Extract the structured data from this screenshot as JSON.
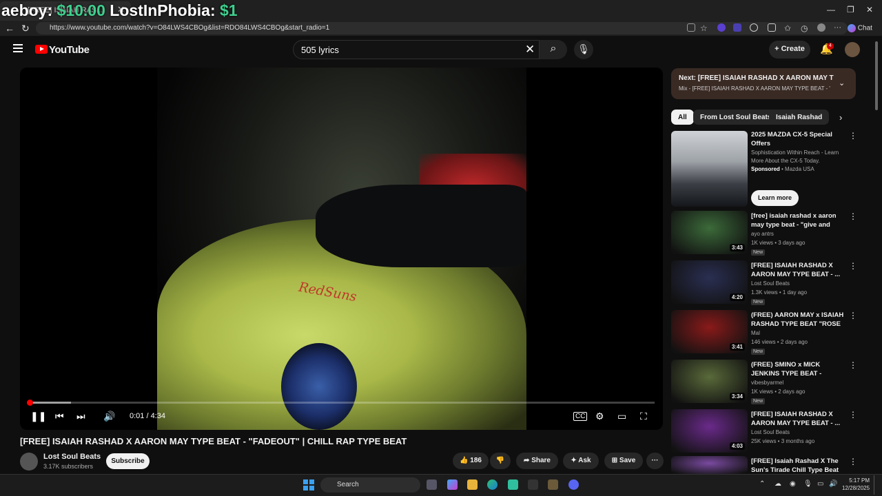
{
  "browser": {
    "tab_title": "[FREE] ISAIAH RAS...",
    "url": "https://www.youtube.com/watch?v=O84LWS4CBOg&list=RDO84LWS4CBOg&start_radio=1",
    "chat_label": "Chat"
  },
  "stream_overlay": {
    "name1": "aeboy: ",
    "amount1": "$10.00",
    "name2": "LostInPhobia: ",
    "amount2": "$1"
  },
  "youtube": {
    "logo_text": "YouTube",
    "search_value": "505 lyrics",
    "create_label": "Create",
    "notification_count": "4"
  },
  "player": {
    "watermark": "RedSuns",
    "time": "0:01 / 4:34",
    "progress_fraction": 0.002,
    "buffered_fraction": 0.068
  },
  "video": {
    "title": "[FREE] ISAIAH RASHAD X AARON MAY TYPE BEAT - \"FADEOUT\" | CHILL RAP TYPE BEAT",
    "channel": "Lost Soul Beats",
    "subscribers": "3.17K subscribers",
    "subscribe_label": "Subscribe",
    "likes": "186",
    "share_label": "Share",
    "ask_label": "Ask",
    "save_label": "Save"
  },
  "next": {
    "title": "Next: [FREE] ISAIAH RASHAD X AARON MAY TYPE ...",
    "subtitle": "Mix - [FREE] ISAIAH RASHAD X AARON MAY TYPE BEAT - \"F..."
  },
  "chips": [
    "All",
    "From Lost Soul Beats",
    "Isaiah Rashad"
  ],
  "ad": {
    "title": "2025 MAZDA CX-5 Special Offers",
    "desc": "Sophistication Within Reach - Learn More About the CX-5 Today.",
    "sponsored": "Sponsored",
    "advertiser": "Mazda USA",
    "cta": "Learn more"
  },
  "recommendations": [
    {
      "title": "[free] isaiah rashad x aaron may type beat - \"give and take\" | chi...",
      "channel": "ayo antrs",
      "meta": "1K views • 3 days ago",
      "badge": "New",
      "duration": "3:43",
      "color": "#3c6b3a"
    },
    {
      "title": "[FREE] ISAIAH RASHAD X AARON MAY TYPE BEAT - ...",
      "channel": "Lost Soul Beats",
      "meta": "1.3K views • 1 day ago",
      "badge": "New",
      "duration": "4:20",
      "color": "#2a2f52"
    },
    {
      "title": "(FREE) AARON MAY x ISAIAH RASHAD TYPE BEAT \"ROSE ...",
      "channel": "Mal",
      "meta": "146 views • 2 days ago",
      "badge": "New",
      "duration": "3:41",
      "color": "#8a1a1a"
    },
    {
      "title": "(FREE) SMINO x MICK JENKINS TYPE BEAT - \"ARPOADOR\" | ...",
      "channel": "vibesbyarmel",
      "meta": "1K views • 2 days ago",
      "badge": "New",
      "duration": "3:34",
      "color": "#5a6a3a"
    },
    {
      "title": "[FREE] ISAIAH RASHAD X AARON MAY TYPE BEAT - ...",
      "channel": "Lost Soul Beats",
      "meta": "25K views • 3 months ago",
      "badge": "",
      "duration": "4:03",
      "color": "#6a2a8a"
    },
    {
      "title": "[FREE] Isaiah Rashad X The Sun's Tirade Chill Type Beat \"O...",
      "channel": "",
      "meta": "",
      "badge": "",
      "duration": "",
      "color": "#7a4aa0"
    }
  ],
  "taskbar": {
    "search_label": "Search",
    "time": "5:17 PM",
    "date": "12/28/2025"
  }
}
